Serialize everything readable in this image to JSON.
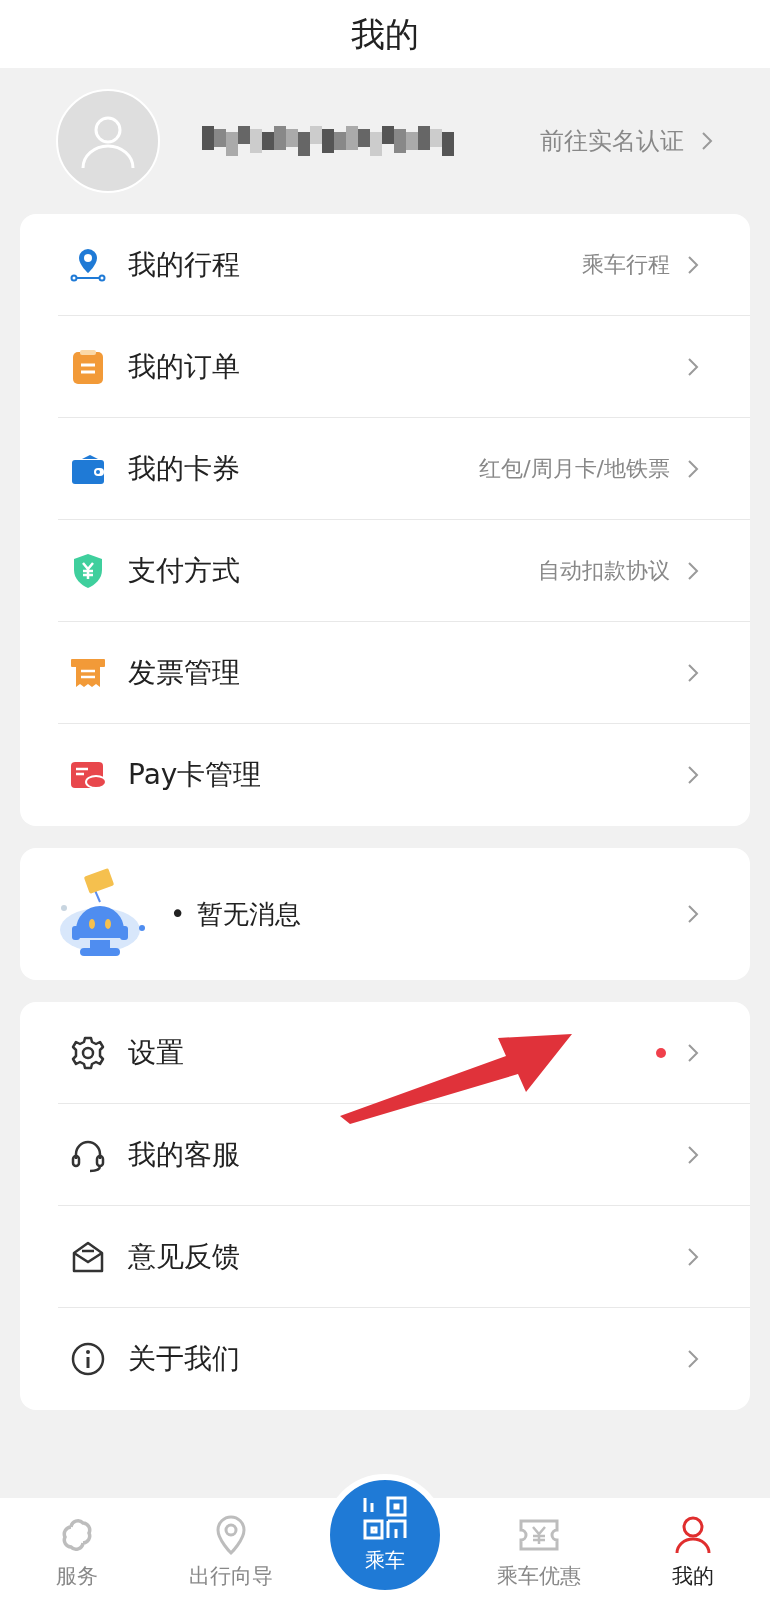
{
  "header": {
    "title": "我的"
  },
  "profile": {
    "verify_link": "前往实名认证"
  },
  "menu_card": [
    {
      "label": "我的行程",
      "hint": "乘车行程"
    },
    {
      "label": "我的订单"
    },
    {
      "label": "我的卡券",
      "hint": "红包/周月卡/地铁票"
    },
    {
      "label": "支付方式",
      "hint": "自动扣款协议"
    },
    {
      "label": "发票管理"
    },
    {
      "label": "Pay卡管理"
    }
  ],
  "message_card": {
    "bullet": "•",
    "text": "暂无消息"
  },
  "settings_card": [
    {
      "label": "设置",
      "badge": true
    },
    {
      "label": "我的客服",
      "badge": false
    },
    {
      "label": "意见反馈",
      "badge": false
    },
    {
      "label": "关于我们",
      "badge": false
    }
  ],
  "tab_bar": [
    {
      "kind": "tab",
      "label": "服务",
      "selected": false
    },
    {
      "kind": "tab",
      "label": "出行向导",
      "selected": false
    },
    {
      "kind": "center",
      "label": "乘车",
      "selected": false
    },
    {
      "kind": "tab",
      "label": "乘车优惠",
      "selected": false
    },
    {
      "kind": "tab",
      "label": "我的",
      "selected": true
    }
  ]
}
